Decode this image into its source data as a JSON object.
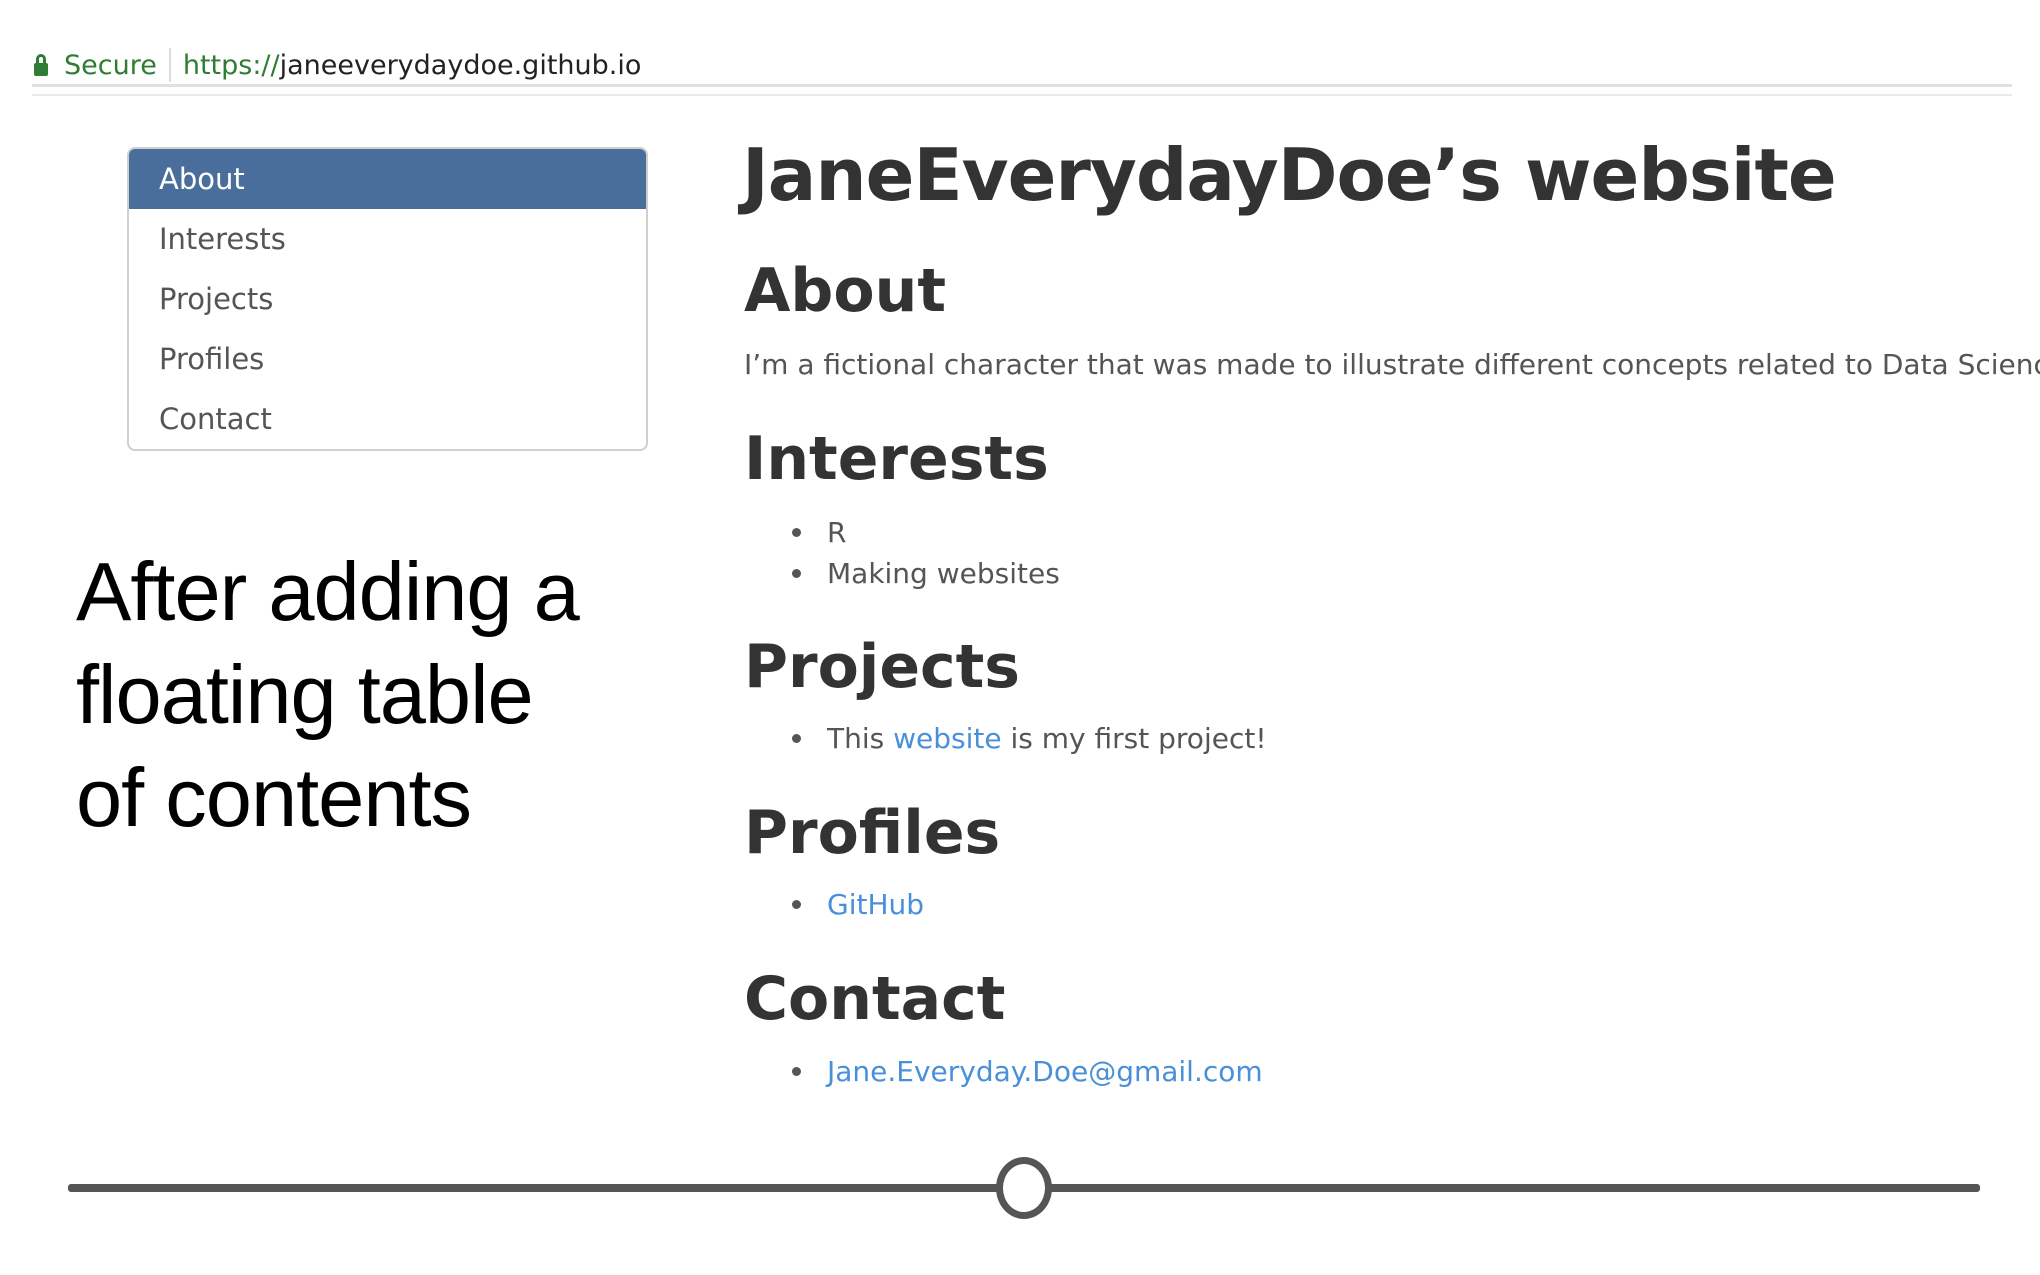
{
  "browser": {
    "secure_label": "Secure",
    "url_scheme": "https://",
    "url_host": "janeeverydaydoe.github.io",
    "lock_icon": "lock-icon",
    "secure_color": "#2e7d32"
  },
  "toc": {
    "active_color": "#4a6e9b",
    "items": [
      {
        "label": "About",
        "active": true
      },
      {
        "label": "Interests",
        "active": false
      },
      {
        "label": "Projects",
        "active": false
      },
      {
        "label": "Profiles",
        "active": false
      },
      {
        "label": "Contact",
        "active": false
      }
    ]
  },
  "annotation": {
    "lines": [
      "After adding a",
      "floating  table",
      "of contents"
    ]
  },
  "page": {
    "title": "JaneEverydayDoe’s website",
    "about": {
      "heading": "About",
      "text": "I’m a fictional character that was made to illustrate different concepts related to Data Science."
    },
    "interests": {
      "heading": "Interests",
      "items": [
        "R",
        "Making websites"
      ]
    },
    "projects": {
      "heading": "Projects",
      "prefix": "This ",
      "link": "website",
      "suffix": " is my first project!"
    },
    "profiles": {
      "heading": "Profiles",
      "items": [
        "GitHub"
      ]
    },
    "contact": {
      "heading": "Contact",
      "items": [
        "Jane.Everyday.Doe@gmail.com"
      ]
    },
    "link_color": "#4a90d9"
  },
  "slider": {
    "position": 0.5
  }
}
